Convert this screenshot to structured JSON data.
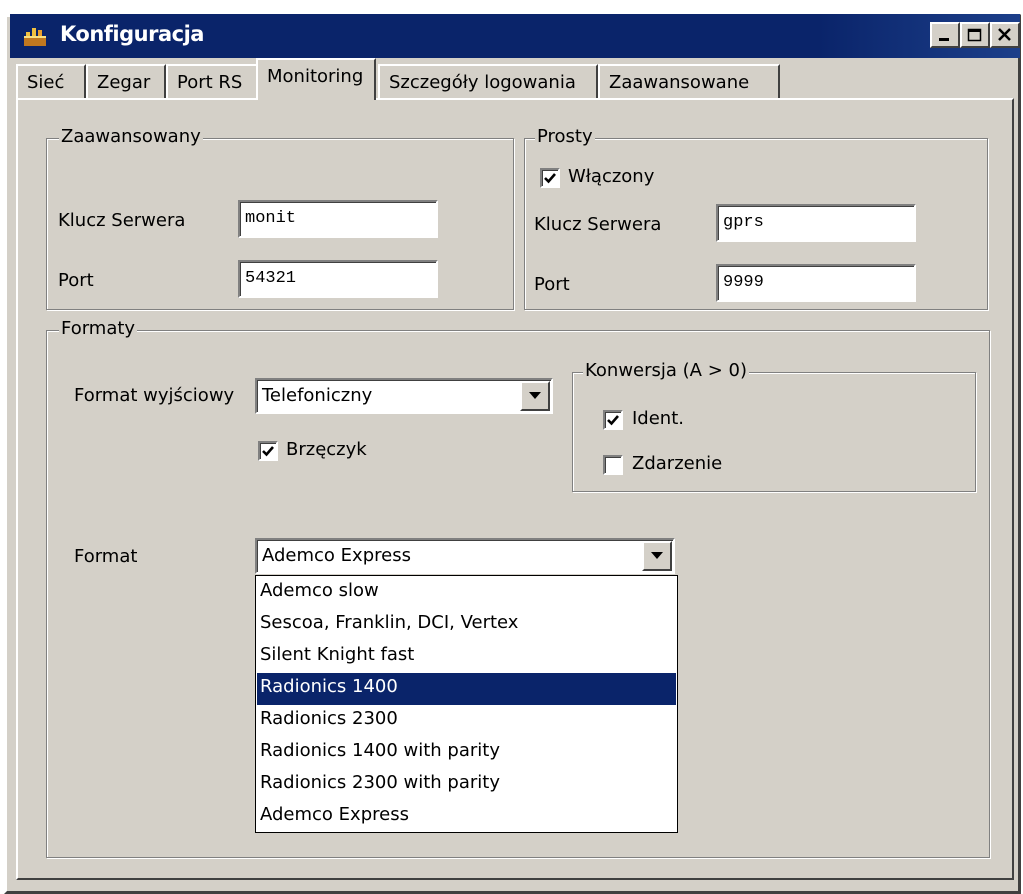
{
  "window": {
    "title": "Konfiguracja"
  },
  "tabs": [
    {
      "label": "Sieć"
    },
    {
      "label": "Zegar"
    },
    {
      "label": "Port RS"
    },
    {
      "label": "Monitoring"
    },
    {
      "label": "Szczegóły logowania"
    },
    {
      "label": "Zaawansowane"
    }
  ],
  "active_tab": "Monitoring",
  "advanced": {
    "title": "Zaawansowany",
    "server_key_label": "Klucz Serwera",
    "server_key_value": "monit",
    "port_label": "Port",
    "port_value": "54321"
  },
  "simple": {
    "title": "Prosty",
    "enabled_label": "Włączony",
    "enabled_checked": true,
    "server_key_label": "Klucz Serwera",
    "server_key_value": "gprs",
    "port_label": "Port",
    "port_value": "9999"
  },
  "formats": {
    "title": "Formaty",
    "output_format_label": "Format wyjściowy",
    "output_format_value": "Telefoniczny",
    "buzzer_label": "Brzęczyk",
    "buzzer_checked": true,
    "conversion": {
      "title": "Konwersja (A > 0)",
      "ident_label": "Ident.",
      "ident_checked": true,
      "event_label": "Zdarzenie",
      "event_checked": false
    },
    "format_label": "Format",
    "format_value": "Ademco Express",
    "format_options": [
      "Ademco slow",
      "Sescoa, Franklin, DCI, Vertex",
      "Silent Knight fast",
      "Radionics 1400",
      "Radionics 2300",
      "Radionics 1400 with parity",
      "Radionics 2300 with parity",
      "Ademco Express"
    ],
    "format_highlighted": "Radionics 1400"
  },
  "colors": {
    "titlebar": "#0a246a",
    "face": "#d4d0c8",
    "highlight": "#0a246a"
  }
}
